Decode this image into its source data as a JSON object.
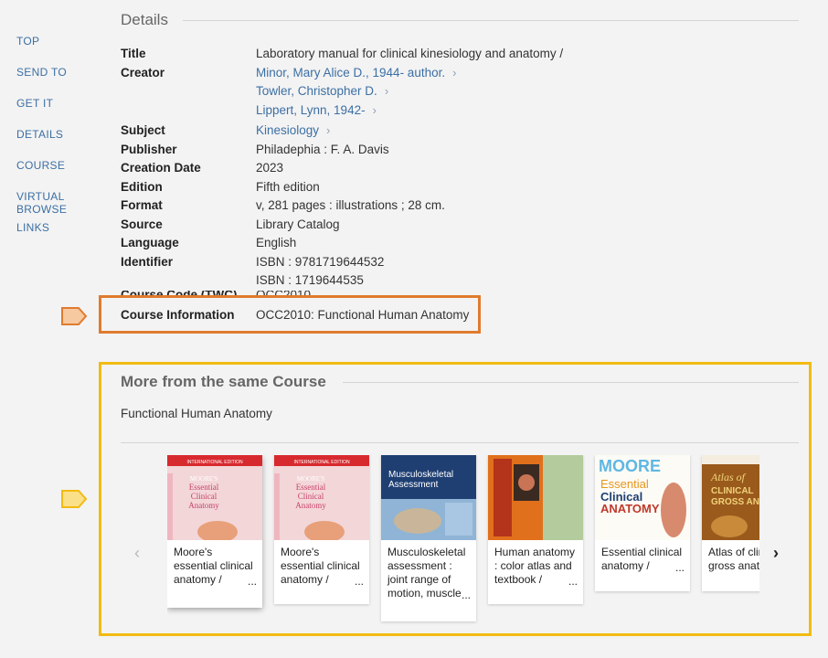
{
  "sidebar": {
    "items": [
      {
        "label": "TOP"
      },
      {
        "label": "SEND TO"
      },
      {
        "label": "GET IT"
      },
      {
        "label": "DETAILS"
      },
      {
        "label": "COURSE"
      },
      {
        "label": "VIRTUAL BROWSE"
      },
      {
        "label": "LINKS"
      }
    ]
  },
  "details": {
    "heading": "Details",
    "title_label": "Title",
    "title_value": "Laboratory manual for clinical kinesiology and anatomy /",
    "creator_label": "Creator",
    "creators": [
      "Minor, Mary Alice D., 1944- author.",
      "Towler, Christopher D.",
      "Lippert, Lynn, 1942-"
    ],
    "subject_label": "Subject",
    "subject_value": "Kinesiology",
    "publisher_label": "Publisher",
    "publisher_value": "Philadephia : F. A. Davis",
    "creation_date_label": "Creation Date",
    "creation_date_value": "2023",
    "edition_label": "Edition",
    "edition_value": "Fifth edition",
    "format_label": "Format",
    "format_value": "v, 281 pages : illustrations ; 28 cm.",
    "source_label": "Source",
    "source_value": "Library Catalog",
    "language_label": "Language",
    "language_value": "English",
    "identifier_label": "Identifier",
    "identifier_values": [
      "ISBN : 9781719644532",
      "ISBN : 1719644535"
    ],
    "course_code_label": "Course Code (TWC)",
    "course_code_value": "OCC2010",
    "course_info_label": "Course Information",
    "course_info_value": "OCC2010: Functional Human Anatomy"
  },
  "more": {
    "heading": "More from the same Course",
    "course_name": "Functional Human Anatomy",
    "prev_glyph": "‹",
    "next_glyph": "›",
    "books": [
      {
        "title": "Moore's essential clinical anatomy /",
        "cover_text": [
          "INTERNATIONAL EDITION",
          "MOORE'S",
          "Essential",
          "Clinical",
          "Anatomy"
        ]
      },
      {
        "title": "Moore's essential clinical anatomy /",
        "cover_text": [
          "INTERNATIONAL EDITION",
          "MOORE'S",
          "Essential",
          "Clinical",
          "Anatomy"
        ]
      },
      {
        "title": "Musculoskeletal assessment : joint range of motion, muscle",
        "cover_text": [
          "Musculoskeletal",
          "Assessment"
        ]
      },
      {
        "title": "Human anatomy : color atlas and textbook /",
        "cover_text": []
      },
      {
        "title": "Essential clinical anatomy /",
        "cover_text": [
          "MOORE",
          "Essential",
          "Clinical",
          "ANATOMY"
        ]
      },
      {
        "title": "Atlas of clinical gross anatomy /",
        "cover_text": [
          "Atlas of",
          "CLINICAL",
          "GROSS AN"
        ]
      }
    ],
    "ellipsis": "..."
  },
  "colors": {
    "link": "#3c6fa3",
    "orange_highlight": "#e07b2e",
    "yellow_highlight": "#f2bb13"
  }
}
